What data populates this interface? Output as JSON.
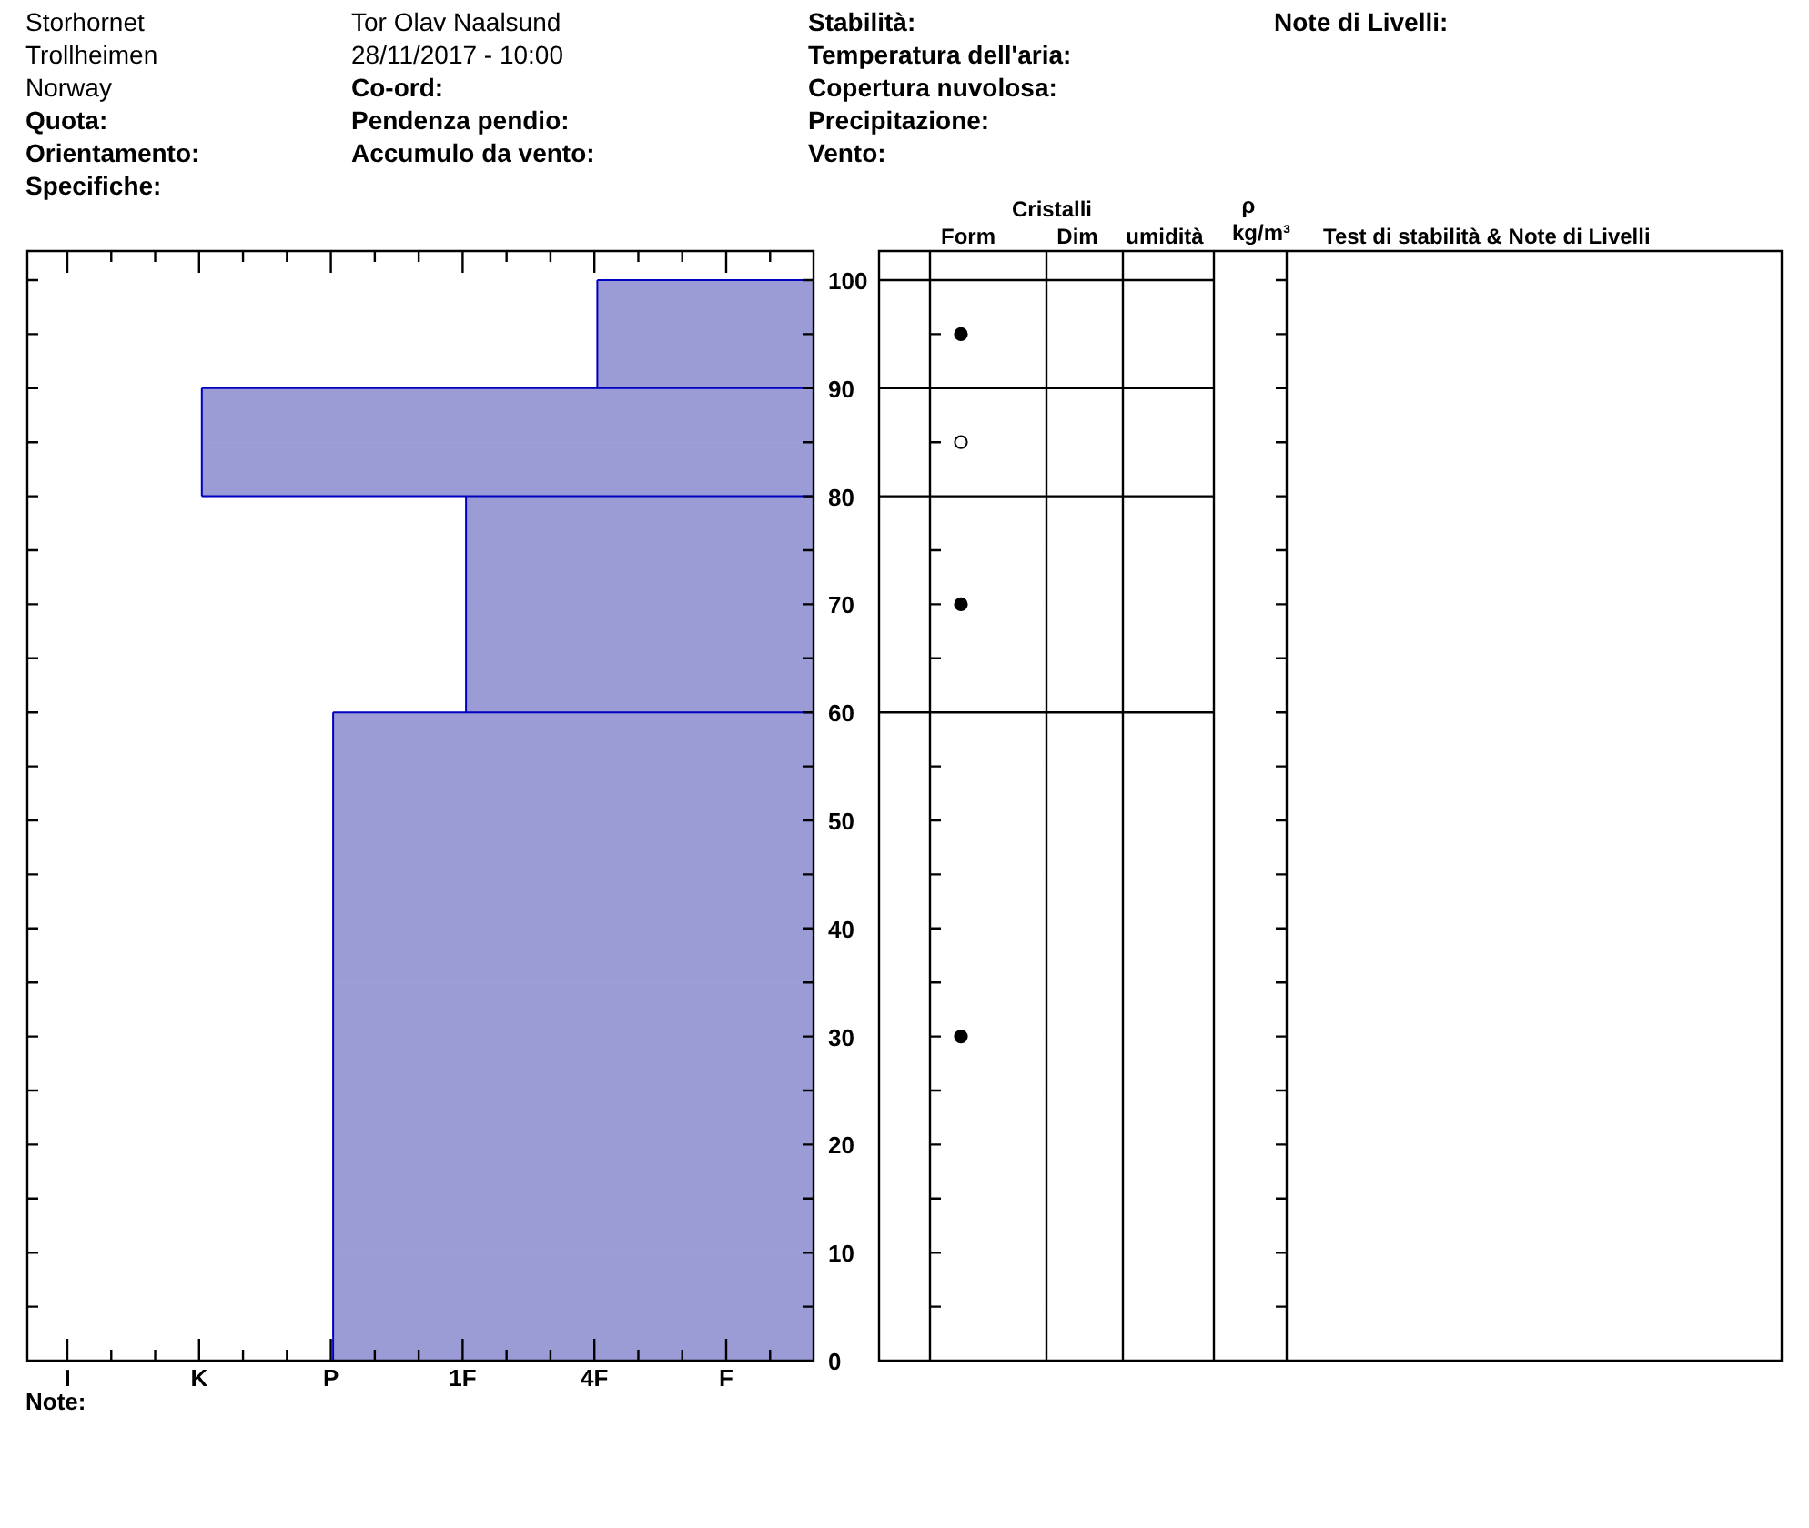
{
  "header": {
    "columns": [
      [
        {
          "kind": "value",
          "text": "Storhornet"
        },
        {
          "kind": "value",
          "text": "Trollheimen"
        },
        {
          "kind": "value",
          "text": "Norway"
        },
        {
          "kind": "label",
          "text": "Quota:"
        },
        {
          "kind": "label",
          "text": "Orientamento:"
        },
        {
          "kind": "label",
          "text": "Specifiche:"
        }
      ],
      [
        {
          "kind": "value",
          "text": "Tor Olav Naalsund"
        },
        {
          "kind": "value",
          "text": "28/11/2017 - 10:00"
        },
        {
          "kind": "label",
          "text": "Co-ord:"
        },
        {
          "kind": "label",
          "text": "Pendenza pendio:"
        },
        {
          "kind": "label",
          "text": "Accumulo da vento:"
        }
      ],
      [
        {
          "kind": "label",
          "text": "Stabilità:"
        },
        {
          "kind": "label",
          "text": "Temperatura dell'aria:"
        },
        {
          "kind": "label",
          "text": "Copertura nuvolosa:"
        },
        {
          "kind": "label",
          "text": "Precipitazione:"
        },
        {
          "kind": "label",
          "text": "Vento:"
        }
      ],
      [
        {
          "kind": "label",
          "text": "Note di Livelli:"
        }
      ]
    ]
  },
  "profile": {
    "height_labels": [
      "100",
      "90",
      "80",
      "70",
      "60",
      "50",
      "40",
      "30",
      "20",
      "10",
      "0"
    ],
    "hardness_labels": [
      "I",
      "K",
      "P",
      "1F",
      "4F",
      "F"
    ],
    "rows": [
      {
        "level": 0.275,
        "kind": "plain"
      },
      {
        "level": 0.275,
        "kind": "dot"
      },
      {
        "level": 0.778,
        "kind": "plain"
      },
      {
        "level": 0.778,
        "kind": "ring"
      },
      {
        "level": 0.442,
        "kind": "plain"
      },
      {
        "level": 0.442,
        "kind": "plain"
      },
      {
        "level": 0.442,
        "kind": "dot"
      },
      {
        "level": 0.442,
        "kind": "plain"
      },
      {
        "level": 0.611,
        "kind": "plain"
      },
      {
        "level": 0.611,
        "kind": "plain"
      },
      {
        "level": 0.611,
        "kind": "plain"
      },
      {
        "level": 0.611,
        "kind": "plain"
      },
      {
        "level": 0.611,
        "kind": "plain"
      },
      {
        "level": 0.611,
        "kind": "plain"
      },
      {
        "level": 0.611,
        "kind": "dot"
      },
      {
        "level": 0.611,
        "kind": "plain"
      },
      {
        "level": 0.611,
        "kind": "plain"
      },
      {
        "level": 0.611,
        "kind": "plain"
      },
      {
        "level": 0.611,
        "kind": "plain"
      },
      {
        "level": 0.611,
        "kind": "plain"
      }
    ],
    "note_label": "Note:"
  },
  "table": {
    "group_heading": "Cristalli",
    "columns": [
      "Form",
      "Dim",
      "umidità"
    ],
    "density_symbol": "ρ",
    "density_unit": "kg/m³",
    "notes_heading": "Test di stabilità & Note di Livelli"
  }
}
